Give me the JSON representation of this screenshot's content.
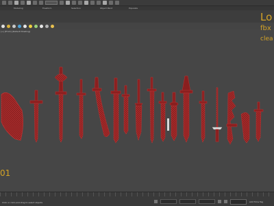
{
  "overlay": {
    "line1": "Lo",
    "line2": "fbx",
    "line3": "clea"
  },
  "viewport": {
    "label": "[+] [Front] [Default Shading]"
  },
  "frame_number": "01",
  "ribbon_tabs": [
    "Modeling",
    "Freeform",
    "Selection",
    "Object Paint",
    "Populate"
  ],
  "status": {
    "message": "Click or click-and-drag to select objects",
    "add_time_tag": "Add Time Tag"
  },
  "colors": {
    "background": "#464646",
    "wire": "#a52a2a",
    "fill": "#7a1818",
    "overlay_text": "#d4a326"
  },
  "icons": [
    "undo-icon",
    "redo-icon",
    "link-icon",
    "unlink-icon",
    "select-icon",
    "move-icon",
    "rotate-icon",
    "scale-icon",
    "snap-icon",
    "render-icon",
    "teapot-icon",
    "sphere-icon",
    "box-icon"
  ]
}
